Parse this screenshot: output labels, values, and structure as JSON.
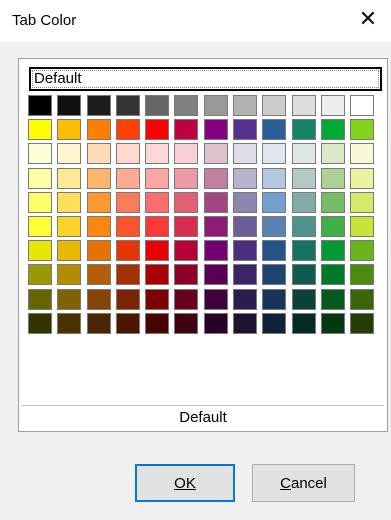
{
  "window": {
    "title": "Tab Color",
    "close_glyph": "✕"
  },
  "palette": {
    "selected_label": "Default",
    "footer_label": "Default",
    "rows": [
      [
        "#000000",
        "#111111",
        "#1c1c1c",
        "#333333",
        "#666666",
        "#808080",
        "#999999",
        "#b2b2b2",
        "#cccccc",
        "#dddddd",
        "#eeeeee",
        "#ffffff"
      ],
      [
        "#ffff00",
        "#ffbf00",
        "#ff8000",
        "#ff4000",
        "#ff0000",
        "#bf0041",
        "#800080",
        "#55308d",
        "#2a6099",
        "#158466",
        "#00a933",
        "#81d41a"
      ],
      [
        "#ffffd7",
        "#fff5ce",
        "#ffdbb6",
        "#ffd8ce",
        "#ffd7d7",
        "#f7d1d5",
        "#e0c2cd",
        "#dedce6",
        "#dee6ef",
        "#dee7e5",
        "#dde8cb",
        "#f6f9d4"
      ],
      [
        "#ffffa6",
        "#ffe994",
        "#ffb66c",
        "#ffaa95",
        "#ffa6a6",
        "#ec9ba4",
        "#bf819e",
        "#b7b3ca",
        "#b4c7dc",
        "#b3cac7",
        "#afd095",
        "#e8f2a1"
      ],
      [
        "#ffff6d",
        "#ffde59",
        "#ff972f",
        "#ff7b59",
        "#ff6d6d",
        "#e16173",
        "#a1467e",
        "#8e86ae",
        "#729fcf",
        "#81aca6",
        "#77bc65",
        "#d4ea6b"
      ],
      [
        "#ffff38",
        "#ffd428",
        "#ff860d",
        "#ff5429",
        "#ff3838",
        "#d62e4e",
        "#8d1d75",
        "#6b5e9b",
        "#5983b0",
        "#50938a",
        "#3faf46",
        "#c9e33a"
      ],
      [
        "#e6e600",
        "#e6b800",
        "#e67300",
        "#e63600",
        "#e60000",
        "#b40035",
        "#730073",
        "#4b2f7f",
        "#225488",
        "#137464",
        "#009933",
        "#6ab31a"
      ],
      [
        "#999900",
        "#b28d00",
        "#b45f06",
        "#a33200",
        "#a80000",
        "#8c0027",
        "#560056",
        "#3a2566",
        "#1e4470",
        "#0f5c4f",
        "#007826",
        "#4f8a10"
      ],
      [
        "#666600",
        "#7f6300",
        "#874206",
        "#7a2600",
        "#7b0000",
        "#66001c",
        "#3d003d",
        "#2b1d4c",
        "#173459",
        "#0b4238",
        "#005a1c",
        "#3b650b"
      ],
      [
        "#333300",
        "#473300",
        "#4a2605",
        "#4d1600",
        "#490000",
        "#3f0011",
        "#290029",
        "#1c1333",
        "#0f2236",
        "#062b24",
        "#003a12",
        "#283d06"
      ]
    ]
  },
  "buttons": {
    "ok": "OK",
    "cancel": "Cancel"
  }
}
